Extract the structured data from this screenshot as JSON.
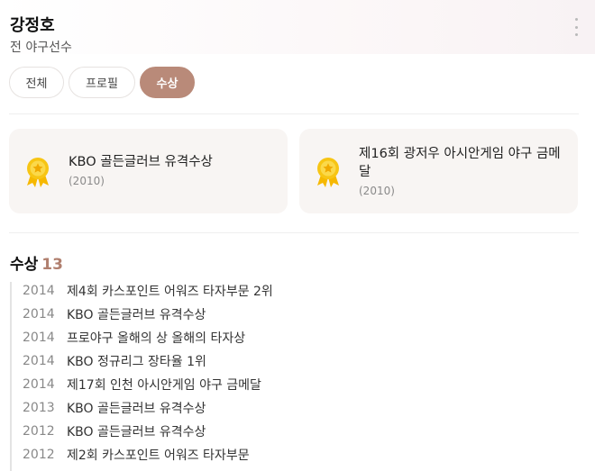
{
  "profile": {
    "name": "강정호",
    "subtitle": "전 야구선수"
  },
  "tabs": [
    {
      "label": "전체",
      "selected": false
    },
    {
      "label": "프로필",
      "selected": false
    },
    {
      "label": "수상",
      "selected": true
    }
  ],
  "featured": [
    {
      "title": "KBO 골든글러브 유격수상",
      "year": "(2010)",
      "icon": "medal-icon"
    },
    {
      "title": "제16회 광저우 아시안게임 야구 금메달",
      "year": "(2010)",
      "icon": "medal-icon"
    }
  ],
  "awards": {
    "title": "수상",
    "count": "13",
    "items": [
      {
        "year": "2014",
        "name": "제4회 카스포인트 어워즈 타자부문 2위"
      },
      {
        "year": "2014",
        "name": "KBO 골든글러브 유격수상"
      },
      {
        "year": "2014",
        "name": "프로야구 올해의 상 올해의 타자상"
      },
      {
        "year": "2014",
        "name": "KBO 정규리그 장타율 1위"
      },
      {
        "year": "2014",
        "name": "제17회 인천 아시안게임 야구 금메달"
      },
      {
        "year": "2013",
        "name": "KBO 골든글러브 유격수상"
      },
      {
        "year": "2012",
        "name": "KBO 골든글러브 유격수상"
      },
      {
        "year": "2012",
        "name": "제2회 카스포인트 어워즈 타자부문"
      }
    ]
  },
  "colors": {
    "accent": "#b98a79",
    "count": "#b07f6e",
    "card_bg": "#f8f5f3",
    "medal_gold": "#f7c514"
  },
  "icons": {
    "more": "more-vertical-icon",
    "medal": "medal-icon"
  }
}
